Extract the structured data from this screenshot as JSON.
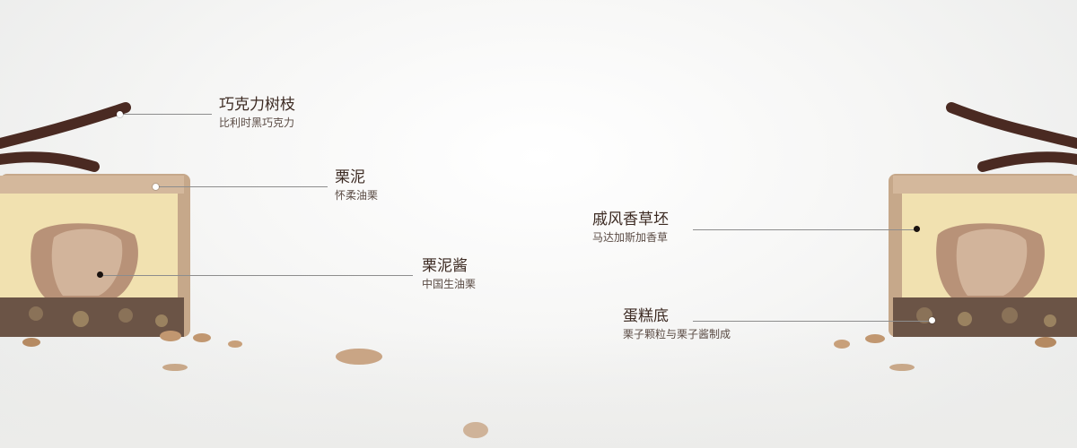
{
  "annotations": [
    {
      "title": "巧克力树枝",
      "subtitle": "比利时黑巧克力"
    },
    {
      "title": "栗泥",
      "subtitle": "怀柔油栗"
    },
    {
      "title": "栗泥酱",
      "subtitle": "中国生油栗"
    },
    {
      "title": "戚风香草坯",
      "subtitle": "马达加斯加香草"
    },
    {
      "title": "蛋糕底",
      "subtitle": "栗子颗粒与栗子酱制成"
    }
  ],
  "colors": {
    "chocolate": "#4a2a22",
    "glaze": "#c6a88a",
    "sponge": "#f1e1b0",
    "chestnut_cream": "#c9a88e",
    "base": "#6b5446",
    "text_title": "#3c2a22",
    "text_sub": "#5a4b44",
    "leader_line": "#8d8d8d"
  }
}
